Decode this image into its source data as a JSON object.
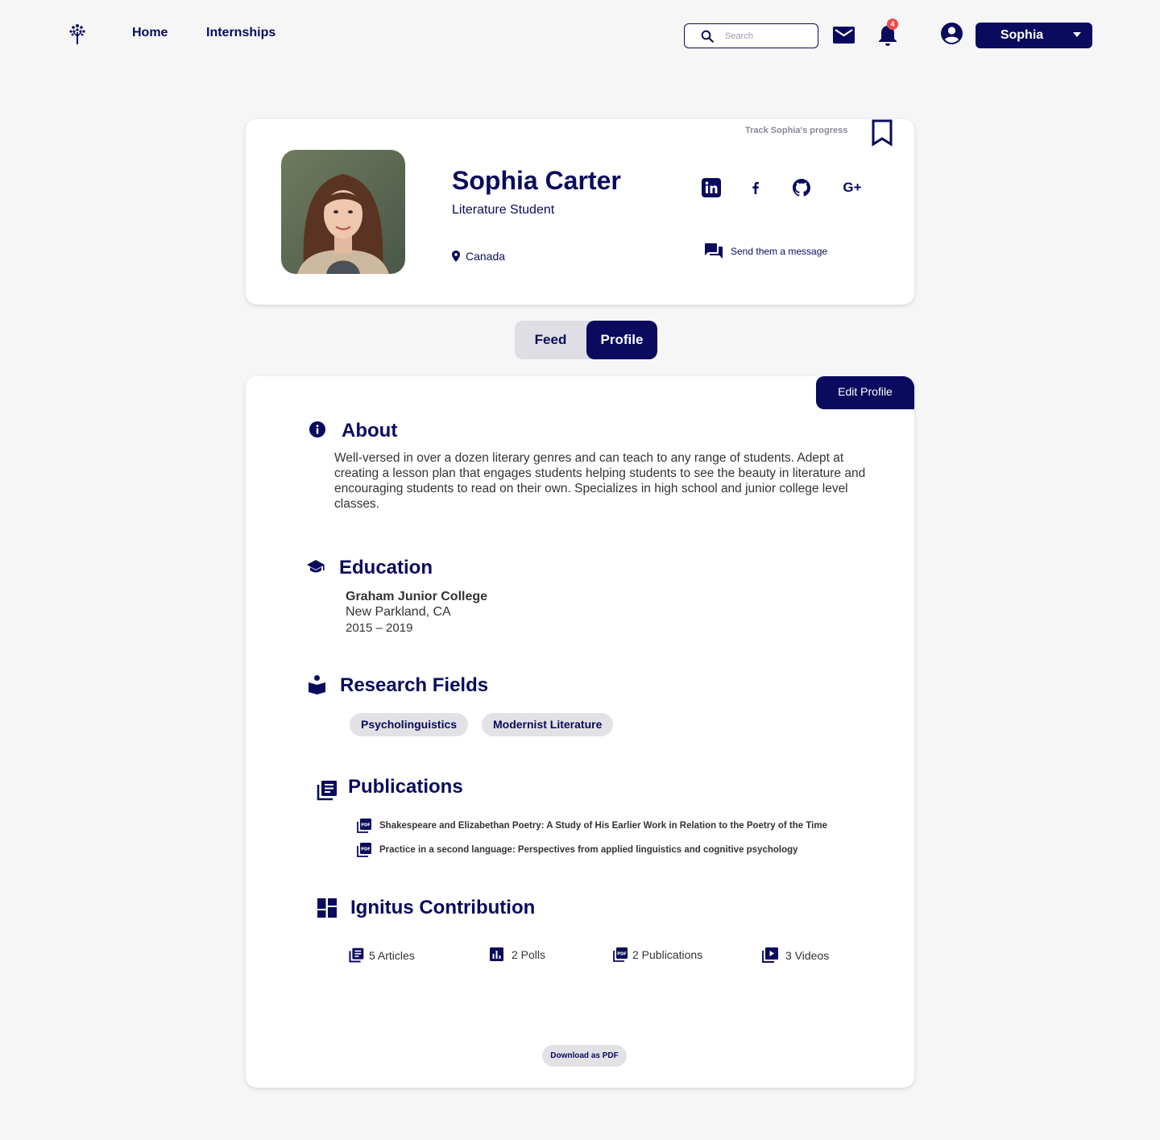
{
  "nav": {
    "links": [
      "Home",
      "Internships"
    ],
    "search_placeholder": "Search",
    "notification_count": "4",
    "user_name": "Sophia"
  },
  "profile": {
    "full_name": "Sophia Carter",
    "role": "Literature Student",
    "location": "Canada",
    "track_label": "Track Sophia's progress",
    "send_message_label": "Send them a message",
    "gplus_label": "G+"
  },
  "tabs": [
    "Feed",
    "Profile"
  ],
  "active_tab": "Profile",
  "edit_profile_label": "Edit Profile",
  "about": {
    "title": "About",
    "text": "Well-versed in over a dozen literary genres and can teach to any range of students. Adept at creating a lesson plan that engages students helping students to see the beauty in literature and encouraging students to read on their own. Specializes in high school and junior college level classes."
  },
  "education": {
    "title": "Education",
    "school": "Graham Junior College",
    "place": "New Parkland, CA",
    "years": "2015 – 2019"
  },
  "research": {
    "title": "Research Fields",
    "fields": [
      "Psycholinguistics",
      "Modernist Literature"
    ]
  },
  "publications": {
    "title": "Publications",
    "items": [
      "Shakespeare and Elizabethan Poetry: A Study of His Earlier Work in Relation to the Poetry of the Time",
      "Practice in a second language: Perspectives from applied linguistics and cognitive psychology"
    ]
  },
  "contribution": {
    "title": "Ignitus Contribution",
    "stats": [
      "5 Articles",
      "2 Polls",
      "2 Publications",
      "3 Videos"
    ]
  },
  "download_label": "Download as PDF",
  "colors": {
    "primary": "#0a0a5e",
    "badge": "#ef4a4a",
    "chip": "#e2e2e6",
    "background": "#f6f6f6"
  },
  "icons": [
    "tree-logo-icon",
    "search-icon",
    "mail-icon",
    "bell-icon",
    "account-circle-icon",
    "caret-down-icon",
    "bookmark-icon",
    "linkedin-icon",
    "facebook-icon",
    "github-icon",
    "google-plus-icon",
    "location-pin-icon",
    "chat-icon",
    "info-icon",
    "graduation-cap-icon",
    "reading-icon",
    "library-books-icon",
    "pdf-icon",
    "dashboard-icon",
    "bar-chart-icon",
    "video-library-icon"
  ]
}
